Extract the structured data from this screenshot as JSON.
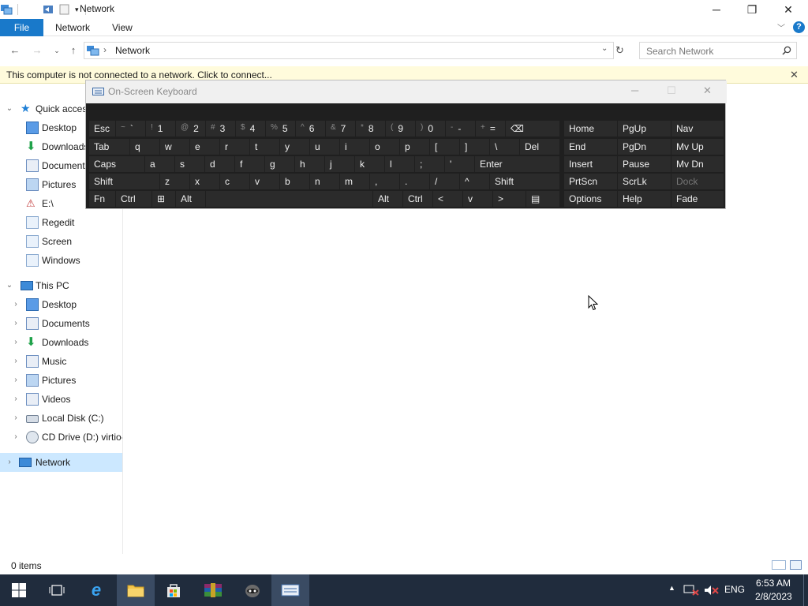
{
  "window": {
    "title": "Network",
    "controls": {
      "minimize": "─",
      "maximize": "❐",
      "close": "✕"
    }
  },
  "ribbon": {
    "tabs": [
      "File",
      "Network",
      "View"
    ]
  },
  "address": {
    "path": "Network",
    "search_placeholder": "Search Network"
  },
  "infobar": {
    "message": "This computer is not connected to a network. Click to connect..."
  },
  "navpane": {
    "quick_access": "Quick access",
    "quick_items": [
      "Desktop",
      "Downloads",
      "Documents",
      "Pictures",
      "E:\\",
      "Regedit",
      "Screen",
      "Windows"
    ],
    "this_pc": "This PC",
    "pc_items": [
      "Desktop",
      "Documents",
      "Downloads",
      "Music",
      "Pictures",
      "Videos",
      "Local Disk (C:)",
      "CD Drive (D:) virtio-"
    ],
    "network": "Network"
  },
  "status": {
    "items": "0 items"
  },
  "osk": {
    "title": "On-Screen Keyboard",
    "row1": [
      {
        "k": "Esc"
      },
      {
        "s": "~",
        "k": "`"
      },
      {
        "s": "!",
        "k": "1"
      },
      {
        "s": "@",
        "k": "2"
      },
      {
        "s": "#",
        "k": "3"
      },
      {
        "s": "$",
        "k": "4"
      },
      {
        "s": "%",
        "k": "5"
      },
      {
        "s": "^",
        "k": "6"
      },
      {
        "s": "&",
        "k": "7"
      },
      {
        "s": "*",
        "k": "8"
      },
      {
        "s": "(",
        "k": "9"
      },
      {
        "s": ")",
        "k": "0"
      },
      {
        "s": "-",
        "k": "-"
      },
      {
        "s": "+",
        "k": "="
      },
      {
        "k": "⌫"
      }
    ],
    "row2": [
      "Tab",
      "q",
      "w",
      "e",
      "r",
      "t",
      "y",
      "u",
      "i",
      "o",
      "p",
      "[",
      "]",
      "\\",
      "Del"
    ],
    "row3": [
      "Caps",
      "a",
      "s",
      "d",
      "f",
      "g",
      "h",
      "j",
      "k",
      "l",
      ";",
      "'",
      "Enter"
    ],
    "row4": [
      "Shift",
      "z",
      "x",
      "c",
      "v",
      "b",
      "n",
      "m",
      ",",
      ".",
      "/",
      "^",
      "Shift"
    ],
    "row5": [
      "Fn",
      "Ctrl",
      "⊞",
      "Alt",
      "",
      "Alt",
      "Ctrl",
      "<",
      "v",
      ">",
      "▤"
    ],
    "side": [
      [
        "Home",
        "PgUp",
        "Nav"
      ],
      [
        "End",
        "PgDn",
        "Mv Up"
      ],
      [
        "Insert",
        "Pause",
        "Mv Dn"
      ],
      [
        "PrtScn",
        "ScrLk",
        "Dock"
      ],
      [
        "Options",
        "Help",
        "Fade"
      ]
    ]
  },
  "taskbar": {
    "language": "ENG",
    "time": "6:53 AM",
    "date": "2/8/2023"
  },
  "colors": {
    "accent": "#1979ca",
    "taskbar": "#202c3d",
    "selection": "#cce8ff",
    "infobar": "#fffbdc",
    "osk_bg": "#1f1f1f"
  }
}
